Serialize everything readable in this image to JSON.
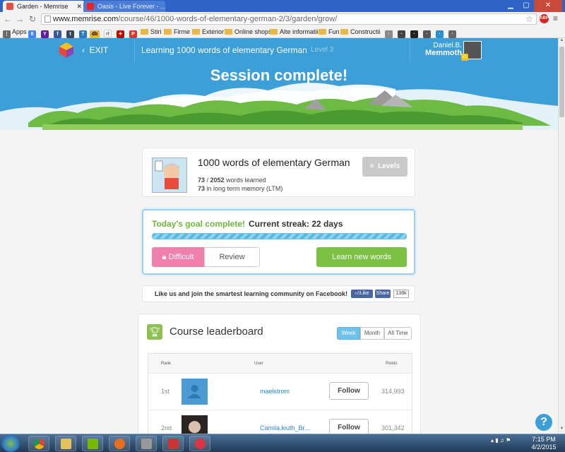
{
  "browser": {
    "tabs": [
      {
        "title": "Garden - Memrise",
        "active": true
      },
      {
        "title": "Oasis - Live Forever - ...",
        "active": false
      }
    ],
    "url_host": "www.memrise.com",
    "url_path": "/course/46/1000-words-of-elementary-german-2/3/garden/grow/",
    "bookmarks": [
      "Apps",
      "Stiri",
      "Firme",
      "Exterior",
      "Online shops",
      "Alte informatii",
      "Fun",
      "Constructii"
    ],
    "bookmark_icons": [
      "apps-icon",
      "google-icon",
      "yahoo-icon",
      "facebook-icon",
      "t-icon",
      "imdb-icon",
      "rl-icon",
      "red-icon",
      "pdf-icon"
    ],
    "adblock_label": "ABP"
  },
  "header": {
    "exit_label": "EXIT",
    "course_title": "Learning 1000 words of elementary German",
    "level": "Level 3",
    "user_name_line1": "Daniel.B.",
    "user_name_line2": "Memmoth",
    "user_level": "21"
  },
  "hero": {
    "title": "Session complete!"
  },
  "course": {
    "name": "1000 words of elementary German",
    "learned_count": "73",
    "total_words": "2052",
    "learned_suffix": " words learned",
    "ltm_count": "73",
    "ltm_suffix": " in long term memory (LTM)",
    "levels_label": "Levels"
  },
  "goal": {
    "complete_text": "Today's goal complete!",
    "streak_text": "Current streak: 22 days",
    "progress": 1.0,
    "difficult_label": "Difficult",
    "review_label": "Review",
    "learn_new_label": "Learn new words"
  },
  "facebook": {
    "text": "Like us and join the smartest learning community on Facebook!",
    "like_label": "Like",
    "share_label": "Share",
    "count": "138k"
  },
  "leaderboard": {
    "title": "Course leaderboard",
    "tabs": [
      "Week",
      "Month",
      "All Time"
    ],
    "selected_tab": "Week",
    "columns": {
      "rank": "Rank",
      "user": "User",
      "points": "Points"
    },
    "rows": [
      {
        "rank": "1st",
        "user": "maelstrom",
        "follow": "Follow",
        "points": "314,993"
      },
      {
        "rank": "2nd",
        "user": "Camila.kiuth_Br...",
        "follow": "Follow",
        "points": "301,342"
      }
    ]
  },
  "help_label": "?",
  "taskbar": {
    "time": "7:15 PM",
    "date": "4/2/2015"
  },
  "colors": {
    "brand_blue": "#3d9fd8",
    "green": "#7bc143",
    "pink": "#ef7fab"
  }
}
